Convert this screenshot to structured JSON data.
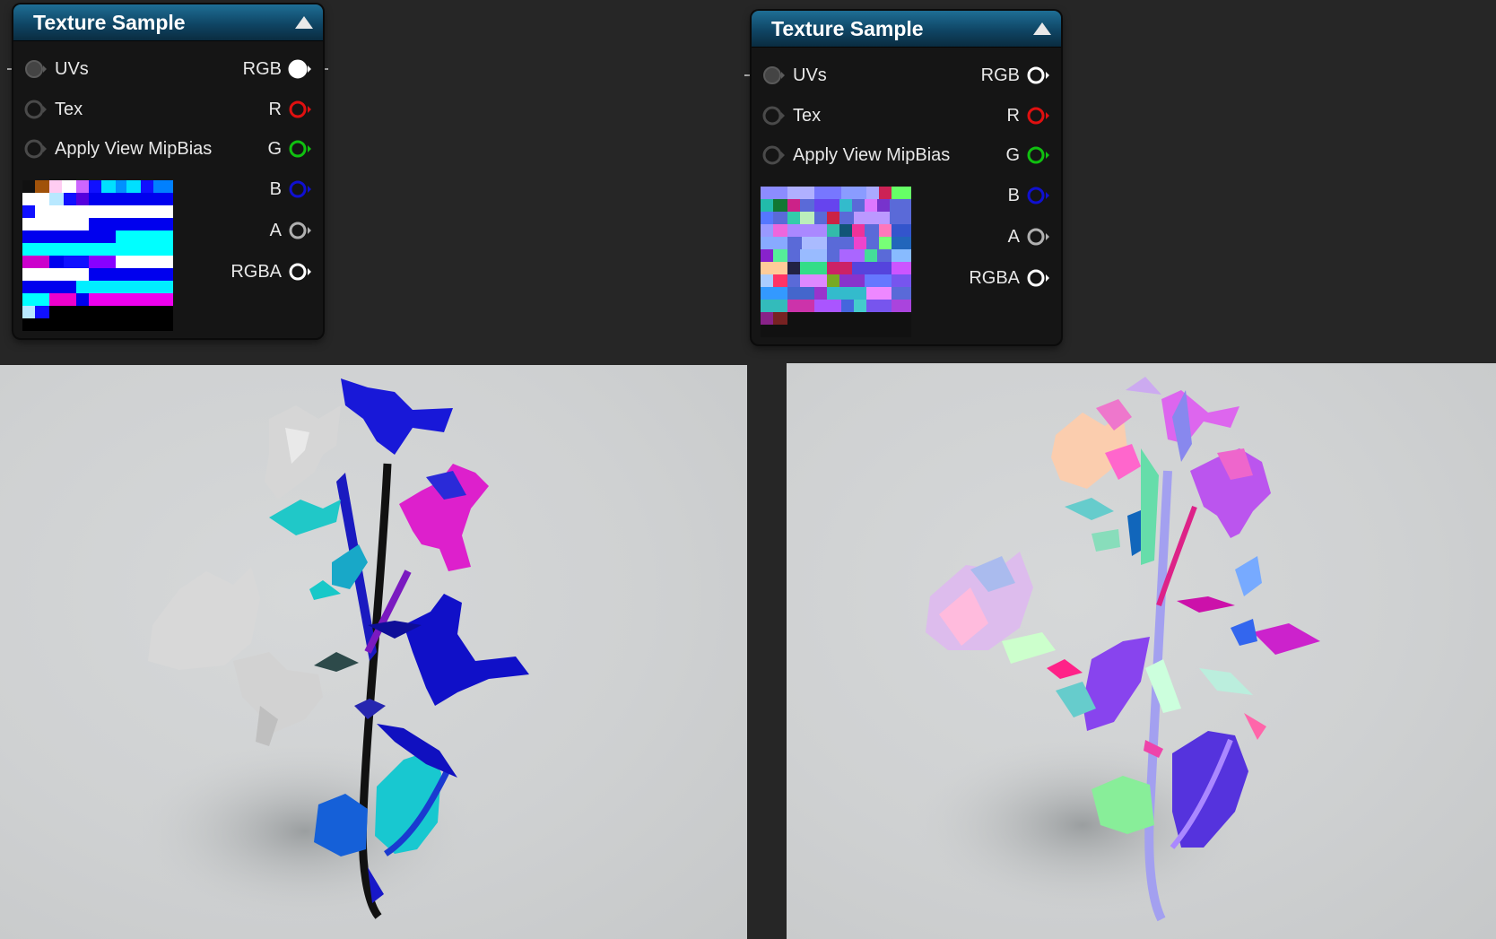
{
  "left_node": {
    "title": "Texture Sample",
    "inputs": [
      {
        "label": "UVs",
        "connected": true
      },
      {
        "label": "Tex",
        "connected": false
      },
      {
        "label": "Apply View MipBias",
        "connected": false
      }
    ],
    "outputs": [
      {
        "label": "RGB",
        "color": "#ffffff",
        "filled": true
      },
      {
        "label": "R",
        "color": "#e01010",
        "filled": false
      },
      {
        "label": "G",
        "color": "#10c010",
        "filled": false
      },
      {
        "label": "B",
        "color": "#1010d0",
        "filled": false
      },
      {
        "label": "A",
        "color": "#b0b0b0",
        "filled": false
      },
      {
        "label": "RGBA",
        "color": "#ffffff",
        "filled": false
      }
    ]
  },
  "right_node": {
    "title": "Texture Sample",
    "inputs": [
      {
        "label": "UVs",
        "connected": true
      },
      {
        "label": "Tex",
        "connected": false
      },
      {
        "label": "Apply View MipBias",
        "connected": false
      }
    ],
    "outputs": [
      {
        "label": "RGB",
        "color": "#ffffff",
        "filled": false
      },
      {
        "label": "R",
        "color": "#e01010",
        "filled": false
      },
      {
        "label": "G",
        "color": "#10c010",
        "filled": false
      },
      {
        "label": "B",
        "color": "#1010d0",
        "filled": false
      },
      {
        "label": "A",
        "color": "#b0b0b0",
        "filled": false
      },
      {
        "label": "RGBA",
        "color": "#ffffff",
        "filled": false
      }
    ]
  },
  "colors": {
    "header_top": "#1e6e95",
    "header_bottom": "#0a2c40",
    "node_bg": "#151515",
    "canvas_bg": "#262626",
    "viewport_bg": "#d0d2d3"
  }
}
